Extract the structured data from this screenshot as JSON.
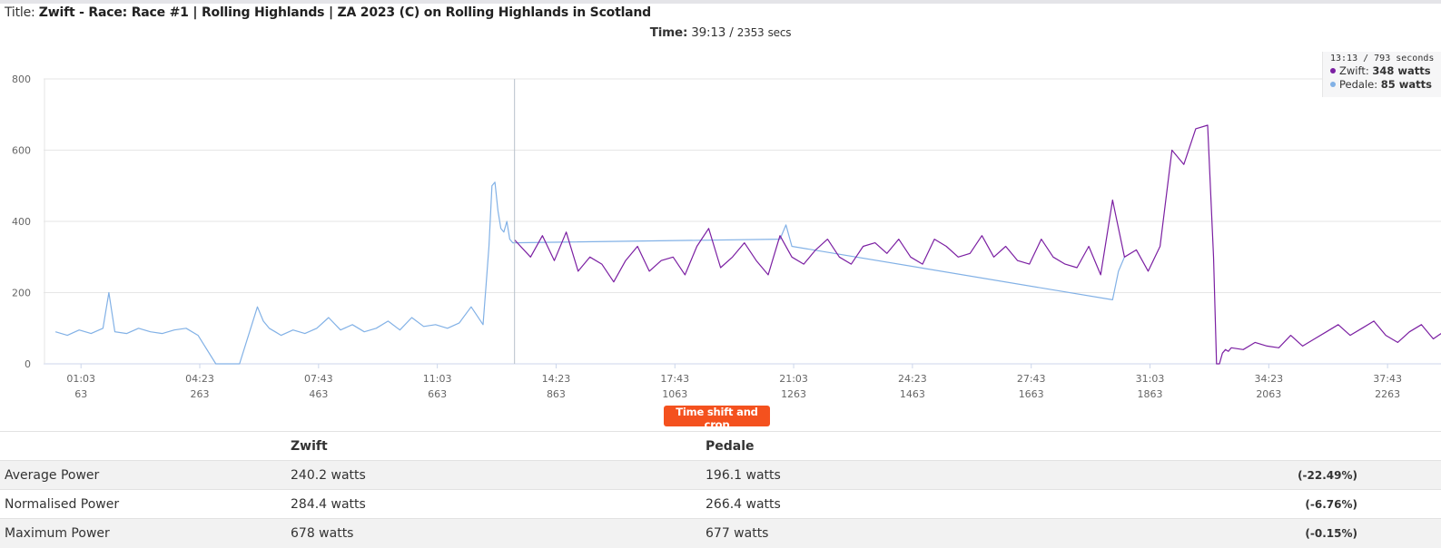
{
  "page": {
    "title_label": "Title:",
    "title_value": "Zwift - Race: Race #1 | Rolling Highlands | ZA 2023 (C) on Rolling Highlands in Scotland",
    "time_label": "Time:",
    "time_value": "39:13 /",
    "time_seconds": "2353",
    "time_unit": "secs"
  },
  "tooltip": {
    "time": "13:13 / 793 seconds",
    "rows": [
      {
        "name": "Zwift",
        "value": "348 watts",
        "color": "#7b1fa2"
      },
      {
        "name": "Pedale",
        "value": "85 watts",
        "color": "#82b1e6"
      }
    ]
  },
  "button": {
    "label": "Time shift and crop",
    "color": "#f4511e"
  },
  "chart_data": {
    "type": "line",
    "ylim": [
      0,
      800
    ],
    "yticks": [
      0,
      200,
      400,
      600,
      800
    ],
    "xlim": [
      0,
      2353
    ],
    "xticks": [
      {
        "time": "01:03",
        "secs": "63"
      },
      {
        "time": "04:23",
        "secs": "263"
      },
      {
        "time": "07:43",
        "secs": "463"
      },
      {
        "time": "11:03",
        "secs": "663"
      },
      {
        "time": "14:23",
        "secs": "863"
      },
      {
        "time": "17:43",
        "secs": "1063"
      },
      {
        "time": "21:03",
        "secs": "1263"
      },
      {
        "time": "24:23",
        "secs": "1463"
      },
      {
        "time": "27:43",
        "secs": "1663"
      },
      {
        "time": "31:03",
        "secs": "1863"
      },
      {
        "time": "34:23",
        "secs": "2063"
      },
      {
        "time": "37:43",
        "secs": "2263"
      }
    ],
    "crosshair_x": 793,
    "series": [
      {
        "name": "Pedale",
        "color": "#82b1e6",
        "x": [
          20,
          40,
          60,
          80,
          100,
          110,
          120,
          140,
          160,
          180,
          200,
          220,
          240,
          260,
          290,
          300,
          330,
          360,
          370,
          380,
          390,
          400,
          420,
          440,
          460,
          480,
          500,
          520,
          540,
          560,
          580,
          600,
          620,
          640,
          660,
          680,
          700,
          720,
          740,
          745,
          750,
          755,
          760,
          765,
          770,
          775,
          780,
          785,
          790,
          1240,
          1250,
          1260,
          1800,
          1810,
          1820
        ],
        "y": [
          90,
          80,
          95,
          85,
          100,
          200,
          90,
          85,
          100,
          90,
          85,
          95,
          100,
          80,
          0,
          0,
          0,
          160,
          120,
          100,
          90,
          80,
          95,
          85,
          100,
          130,
          95,
          110,
          90,
          100,
          120,
          95,
          130,
          105,
          110,
          100,
          115,
          160,
          110,
          220,
          330,
          500,
          510,
          430,
          380,
          370,
          400,
          350,
          340,
          350,
          390,
          330,
          180,
          260,
          300
        ]
      },
      {
        "name": "Zwift",
        "color": "#7b1fa2",
        "x": [
          793,
          820,
          840,
          860,
          880,
          900,
          920,
          940,
          960,
          980,
          1000,
          1020,
          1040,
          1060,
          1080,
          1100,
          1120,
          1140,
          1160,
          1180,
          1200,
          1220,
          1240,
          1260,
          1280,
          1300,
          1320,
          1340,
          1360,
          1380,
          1400,
          1420,
          1440,
          1460,
          1480,
          1500,
          1520,
          1540,
          1560,
          1580,
          1600,
          1620,
          1640,
          1660,
          1680,
          1700,
          1720,
          1740,
          1760,
          1780,
          1800,
          1820,
          1840,
          1860,
          1880,
          1900,
          1920,
          1940,
          1960,
          1970,
          1975,
          1980,
          1985,
          1990,
          1995,
          2000,
          2020,
          2040,
          2060,
          2080,
          2100,
          2120,
          2140,
          2160,
          2180,
          2200,
          2220,
          2240,
          2260,
          2280,
          2300,
          2320,
          2340,
          2353
        ],
        "y": [
          348,
          300,
          360,
          290,
          370,
          260,
          300,
          280,
          230,
          290,
          330,
          260,
          290,
          300,
          250,
          330,
          380,
          270,
          300,
          340,
          290,
          250,
          360,
          300,
          280,
          320,
          350,
          300,
          280,
          330,
          340,
          310,
          350,
          300,
          280,
          350,
          330,
          300,
          310,
          360,
          300,
          330,
          290,
          280,
          350,
          300,
          280,
          270,
          330,
          250,
          460,
          300,
          320,
          260,
          330,
          600,
          560,
          660,
          670,
          300,
          0,
          0,
          30,
          40,
          35,
          45,
          40,
          60,
          50,
          45,
          80,
          50,
          70,
          90,
          110,
          80,
          100,
          120,
          80,
          60,
          90,
          110,
          70,
          85
        ]
      }
    ]
  },
  "stats": {
    "headers": [
      "",
      "Zwift",
      "Pedale",
      ""
    ],
    "rows": [
      {
        "label": "Average Power",
        "zwift": "240.2 watts",
        "pedale": "196.1 watts",
        "diff": "(-22.49%)"
      },
      {
        "label": "Normalised Power",
        "zwift": "284.4 watts",
        "pedale": "266.4 watts",
        "diff": "(-6.76%)"
      },
      {
        "label": "Maximum Power",
        "zwift": "678 watts",
        "pedale": "677 watts",
        "diff": "(-0.15%)"
      }
    ]
  }
}
